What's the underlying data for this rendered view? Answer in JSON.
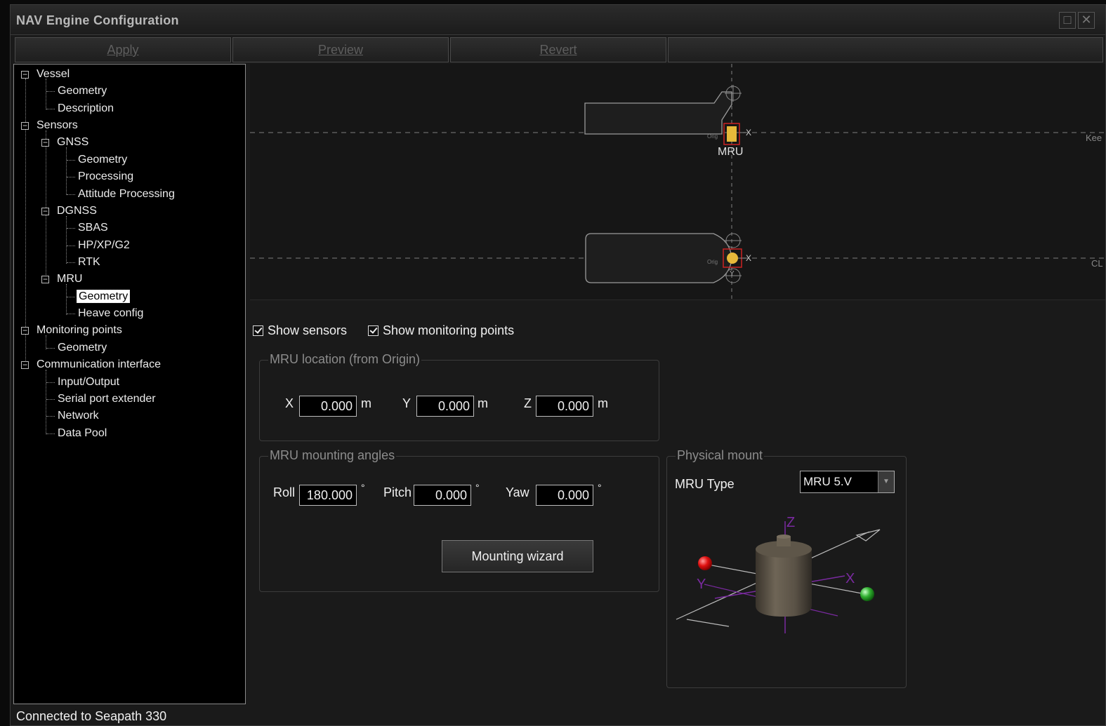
{
  "window": {
    "title": "NAV Engine Configuration"
  },
  "toolbar": {
    "apply": "Apply",
    "preview": "Preview",
    "revert": "Revert"
  },
  "tree": {
    "vessel": "Vessel",
    "vessel_geometry": "Geometry",
    "vessel_description": "Description",
    "sensors": "Sensors",
    "gnss": "GNSS",
    "gnss_geometry": "Geometry",
    "gnss_processing": "Processing",
    "gnss_attitude": "Attitude Processing",
    "dgnss": "DGNSS",
    "dgnss_sbas": "SBAS",
    "dgnss_hp": "HP/XP/G2",
    "dgnss_rtk": "RTK",
    "mru": "MRU",
    "mru_geometry": "Geometry",
    "mru_heave": "Heave config",
    "monitoring": "Monitoring points",
    "monitoring_geometry": "Geometry",
    "comm": "Communication interface",
    "comm_io": "Input/Output",
    "comm_serial": "Serial port extender",
    "comm_network": "Network",
    "comm_datapool": "Data Pool"
  },
  "viewport": {
    "top_label": "MRU",
    "keel_label": "Kee",
    "cl_label": "CL",
    "origin_label": "Orig",
    "x_axis": "X",
    "y_axis": "Y"
  },
  "options": {
    "show_sensors": "Show sensors",
    "show_monitoring": "Show monitoring points"
  },
  "location": {
    "legend": "MRU location (from Origin)",
    "x_label": "X",
    "x_value": "0.000",
    "y_label": "Y",
    "y_value": "0.000",
    "z_label": "Z",
    "z_value": "0.000",
    "unit": "m"
  },
  "angles": {
    "legend": "MRU mounting angles",
    "roll_label": "Roll",
    "roll_value": "180.000",
    "pitch_label": "Pitch",
    "pitch_value": "0.000",
    "yaw_label": "Yaw",
    "yaw_value": "0.000",
    "unit": "°",
    "wizard": "Mounting wizard"
  },
  "mount": {
    "legend": "Physical mount",
    "type_label": "MRU Type",
    "type_value": "MRU 5.V",
    "axis_z": "Z",
    "axis_x": "X",
    "axis_y": "Y"
  },
  "status": {
    "text": "Connected to Seapath 330"
  }
}
